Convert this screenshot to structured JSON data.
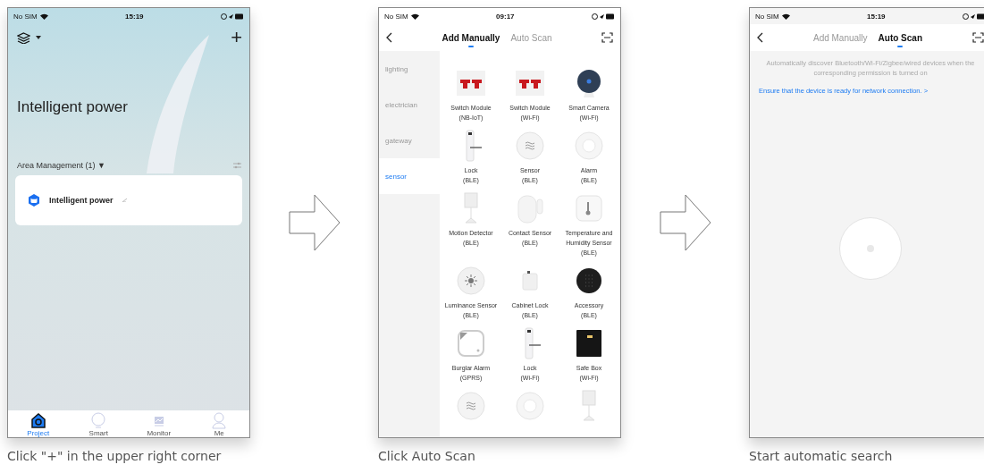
{
  "steps": [
    {
      "kind": "home",
      "status": {
        "carrier": "No SIM",
        "time": "15:19"
      },
      "add": "+",
      "title": "Intelligent power",
      "area": {
        "label": "Area Management (1)",
        "caret": "▼"
      },
      "card": {
        "name": "Intelligent power"
      },
      "tabbar": [
        {
          "label": "Project",
          "kind": "home",
          "selected": true
        },
        {
          "label": "Smart",
          "kind": "bulb",
          "selected": false
        },
        {
          "label": "Monitor",
          "kind": "chart",
          "selected": false
        },
        {
          "label": "Me",
          "kind": "person",
          "selected": false
        }
      ],
      "caption": "Click \"+\" in the upper right corner"
    },
    {
      "kind": "add",
      "status": {
        "carrier": "No SIM",
        "time": "09:17"
      },
      "tabs": [
        {
          "label": "Add Manually",
          "selected": true
        },
        {
          "label": "Auto Scan",
          "selected": false
        }
      ],
      "categories": [
        {
          "label": "lighting",
          "selected": false
        },
        {
          "label": "electrician",
          "selected": false
        },
        {
          "label": "gateway",
          "selected": false
        },
        {
          "label": "sensor",
          "selected": true
        }
      ],
      "devices": [
        {
          "kind": "switch",
          "name": "Switch Module",
          "sub": "(NB-IoT)"
        },
        {
          "kind": "switch",
          "name": "Switch Module",
          "sub": "(Wi-Fi)"
        },
        {
          "kind": "camera",
          "name": "Smart Camera",
          "sub": "(Wi-Fi)"
        },
        {
          "kind": "lock",
          "name": "Lock",
          "sub": "(BLE)"
        },
        {
          "kind": "sensor",
          "name": "Sensor",
          "sub": "(BLE)"
        },
        {
          "kind": "alarm",
          "name": "Alarm",
          "sub": "(BLE)"
        },
        {
          "kind": "motion",
          "name": "Motion Detector",
          "sub": "(BLE)"
        },
        {
          "kind": "contact",
          "name": "Contact Sensor",
          "sub": "(BLE)"
        },
        {
          "kind": "thermo",
          "name": "Temperature and Humidity Sensor",
          "sub": "(BLE)"
        },
        {
          "kind": "lux",
          "name": "Luminance Sensor",
          "sub": "(BLE)"
        },
        {
          "kind": "cabinet",
          "name": "Cabinet Lock",
          "sub": "(BLE)"
        },
        {
          "kind": "keypad",
          "name": "Accessory",
          "sub": "(BLE)"
        },
        {
          "kind": "burglar",
          "name": "Burglar Alarm",
          "sub": "(GPRS)"
        },
        {
          "kind": "lock",
          "name": "Lock",
          "sub": "(Wi-Fi)"
        },
        {
          "kind": "safe",
          "name": "Safe Box",
          "sub": "(Wi-Fi)"
        },
        {
          "kind": "sensor"
        },
        {
          "kind": "alarm"
        },
        {
          "kind": "motion"
        }
      ],
      "caption": "Click Auto Scan"
    },
    {
      "kind": "scan",
      "status": {
        "carrier": "No SIM",
        "time": "15:19"
      },
      "tabs": [
        {
          "label": "Add Manually",
          "selected": false
        },
        {
          "label": "Auto Scan",
          "selected": true
        }
      ],
      "hint": "Automatically discover Bluetooth/Wi-Fi/Zigbee/wired devices when the corresponding permission is turned on",
      "link": "Ensure that the device is ready for network connection. >",
      "caption": "Start automatic search"
    }
  ]
}
